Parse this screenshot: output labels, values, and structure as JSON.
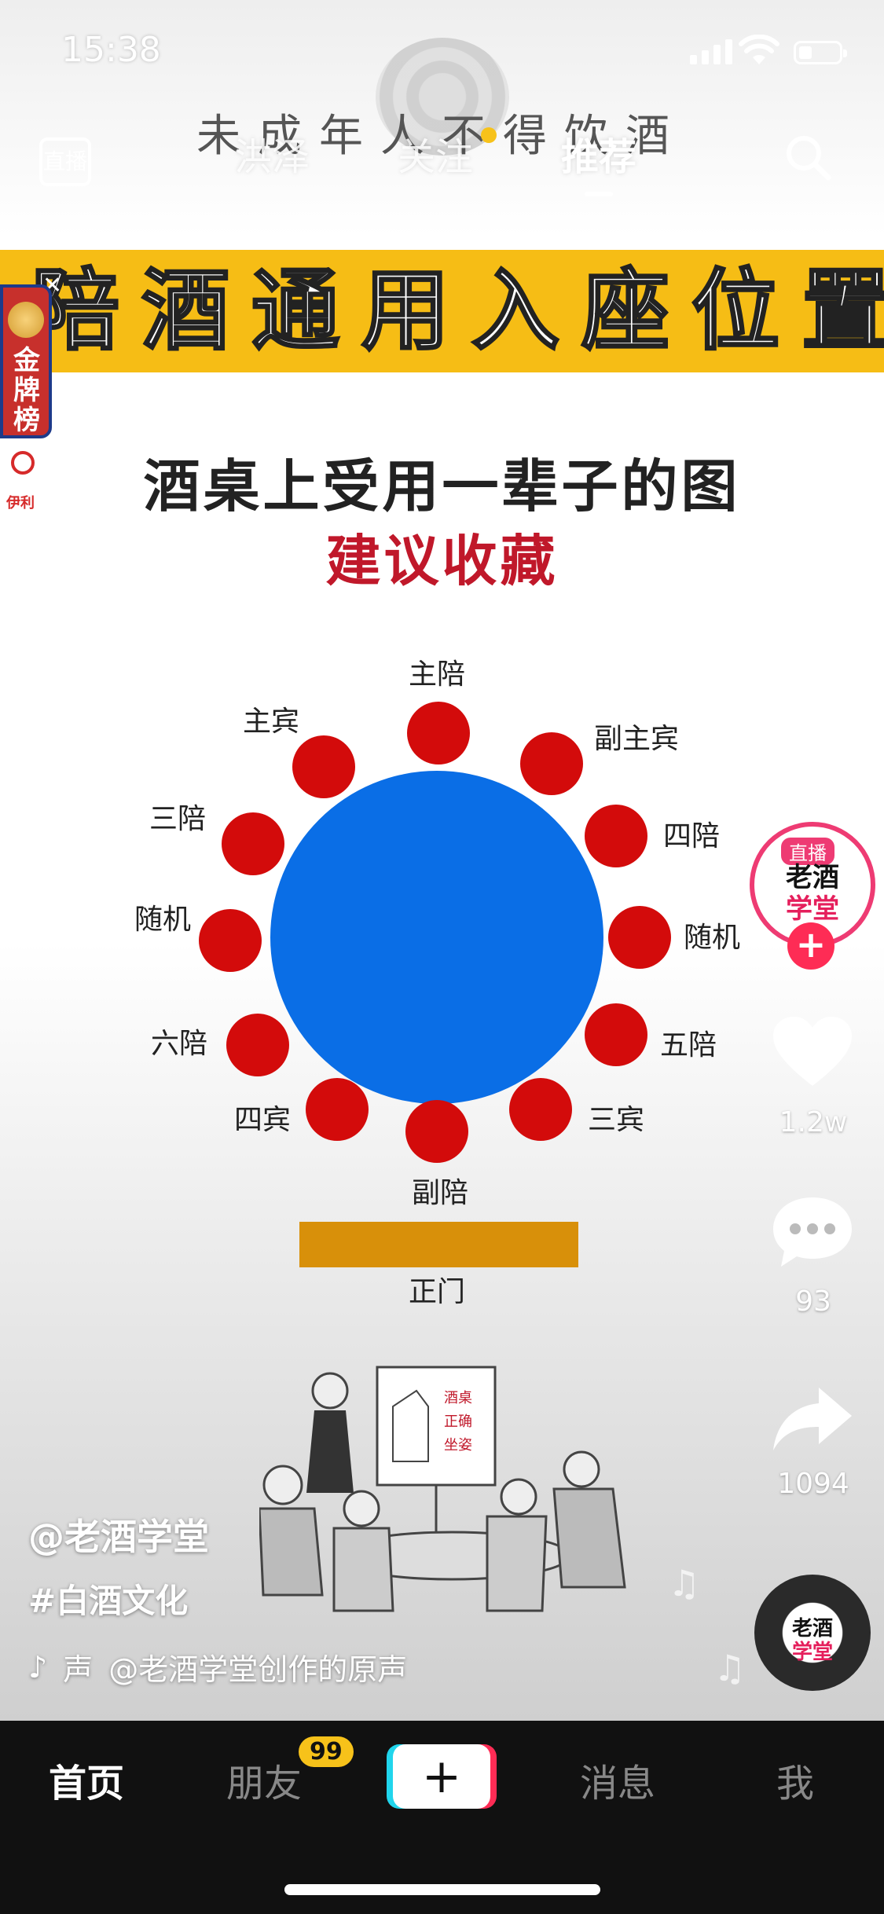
{
  "status_bar": {
    "time": "15:38"
  },
  "overlay": {
    "warning": "未成年人不得饮酒"
  },
  "top_nav": {
    "live_label": "直播",
    "tabs": [
      {
        "label": "洪泽",
        "active": false
      },
      {
        "label": "关注",
        "active": false
      },
      {
        "label": "推荐",
        "active": true
      }
    ]
  },
  "video": {
    "banner": "陪酒通用入座位置",
    "medal_text": "金牌榜",
    "headline": "酒桌上受用一辈子的图",
    "subheadline": "建议收藏",
    "seats": {
      "top": "主陪",
      "top_left": "主宾",
      "top_right": "副主宾",
      "left1": "三陪",
      "right1": "四陪",
      "left2": "随机",
      "right2": "随机",
      "left3": "六陪",
      "right3": "五陪",
      "bottom_left": "四宾",
      "bottom_right": "三宾",
      "bottom": "副陪"
    },
    "door_label": "正门",
    "cartoon_board": [
      "酒桌",
      "正确",
      "坐姿"
    ],
    "colors": {
      "table": "#0a6ee6",
      "seat": "#d30b0b",
      "door": "#d8900a",
      "banner": "#f6bd15"
    }
  },
  "caption": {
    "username": "@老酒学堂",
    "hashtag": "#白酒文化",
    "music_left": "声",
    "music": "@老酒学堂创作的原声"
  },
  "creator": {
    "live_tag": "直播",
    "name_line1": "老酒",
    "name_line2": "学堂"
  },
  "actions": {
    "likes": "1.2w",
    "comments": "93",
    "shares": "1094"
  },
  "tab_bar": {
    "home": "首页",
    "friends": "朋友",
    "friends_badge": "99",
    "messages": "消息",
    "me": "我"
  }
}
